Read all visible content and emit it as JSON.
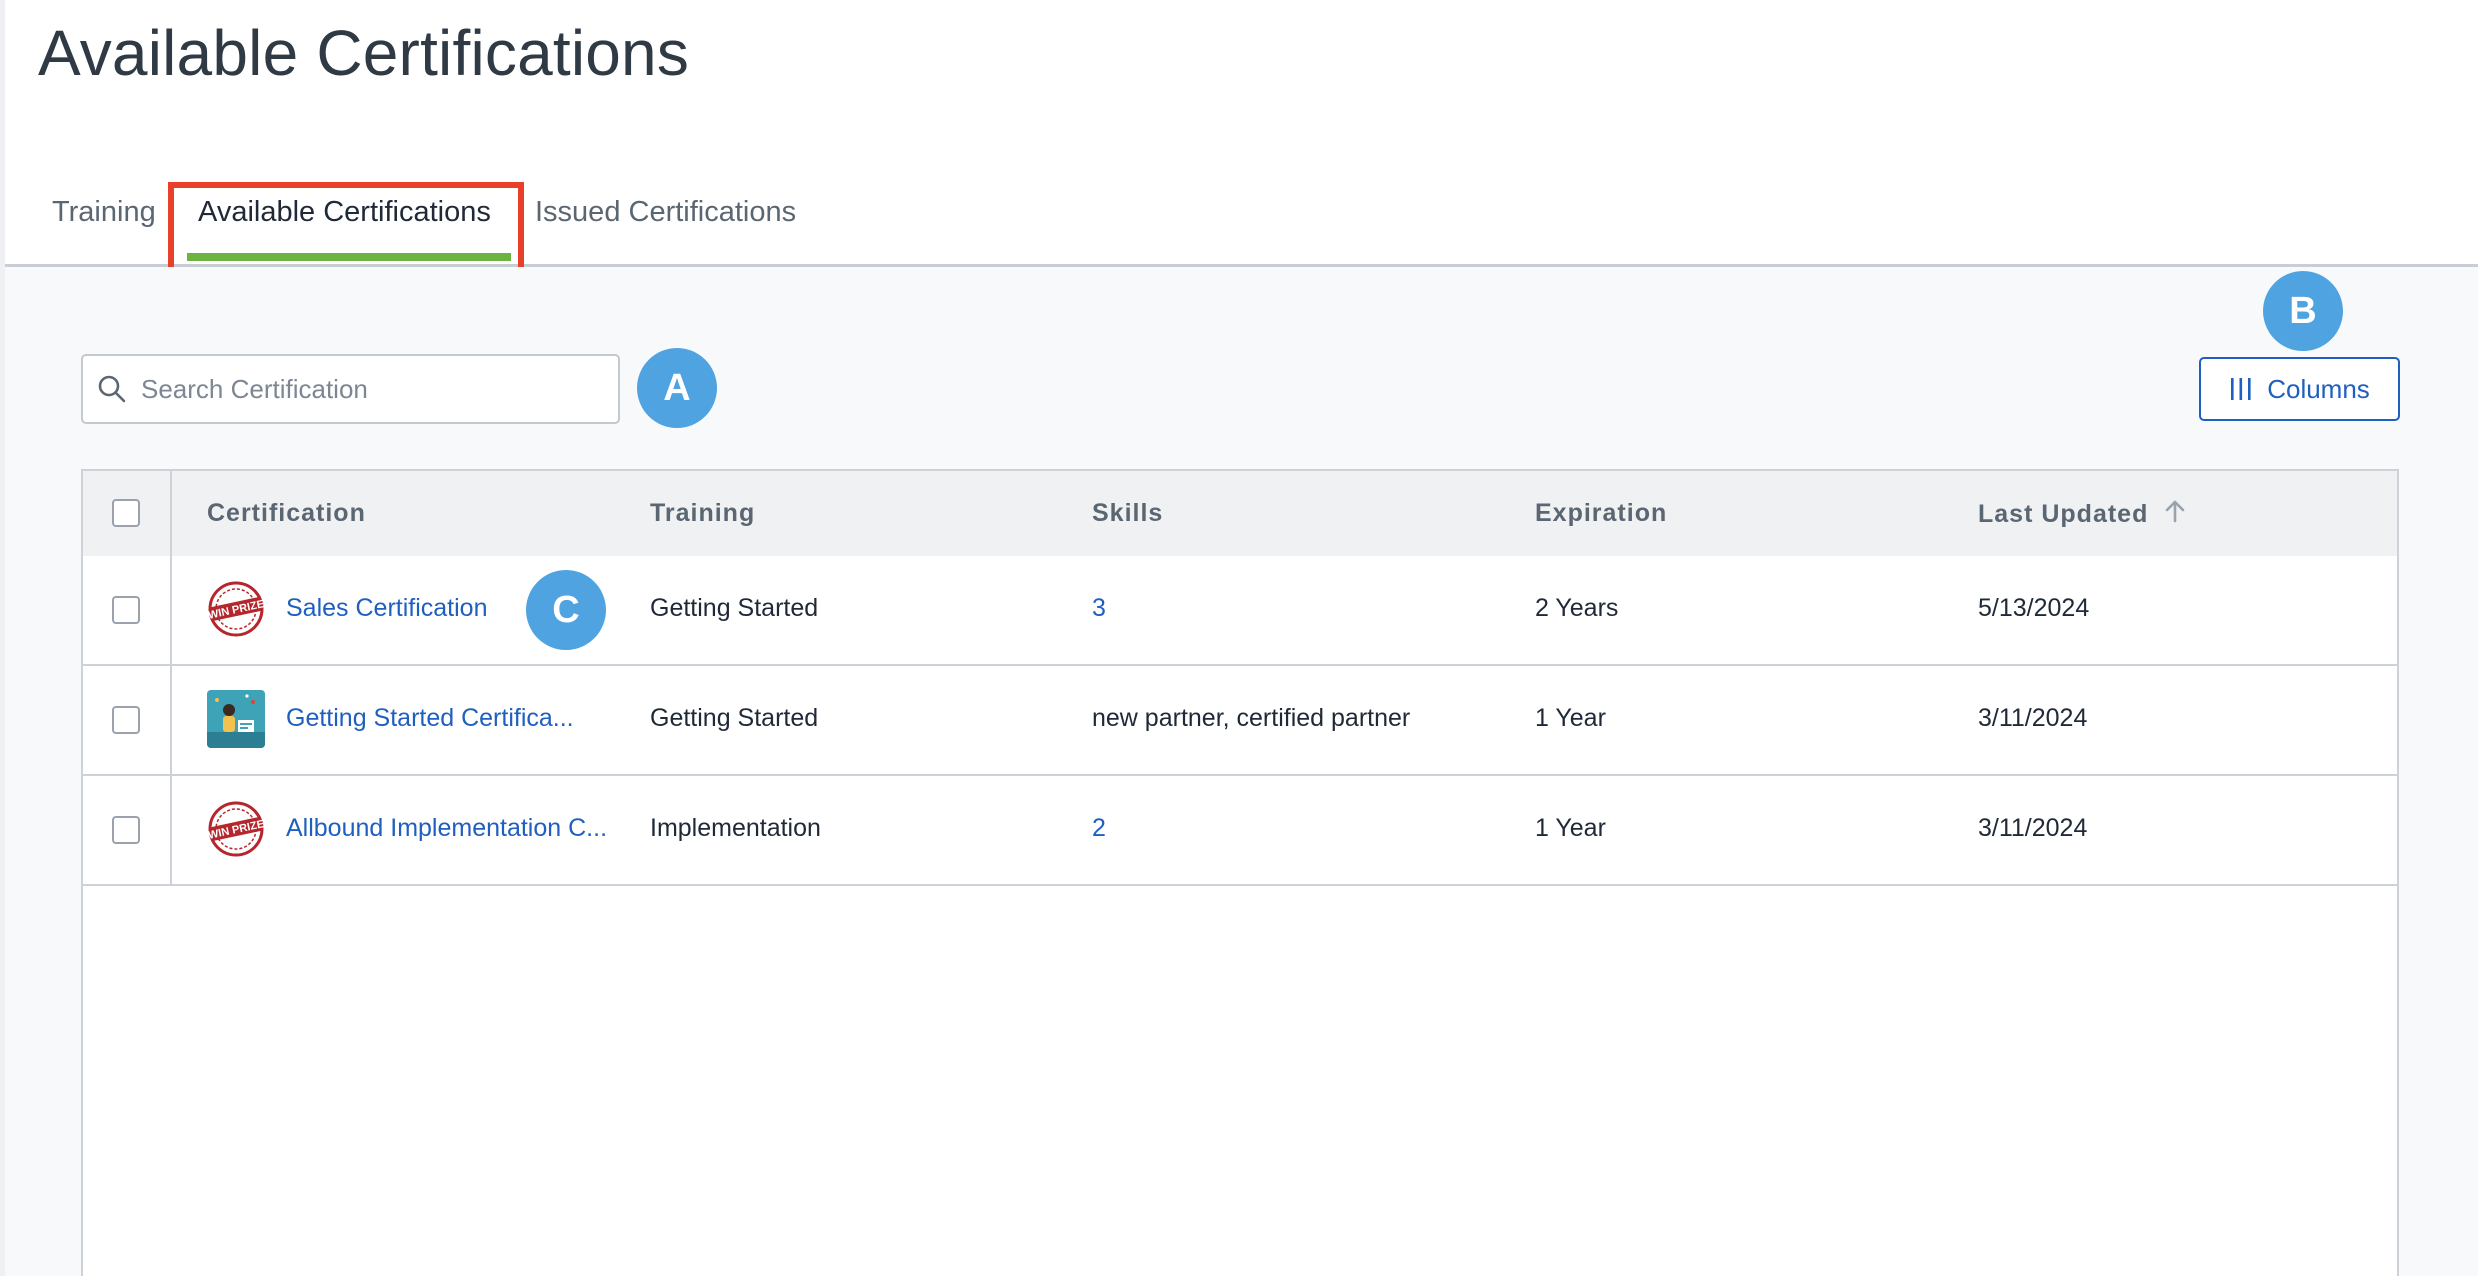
{
  "page": {
    "title": "Available Certifications"
  },
  "tabs": [
    {
      "label": "Training",
      "active": false
    },
    {
      "label": "Available Certifications",
      "active": true
    },
    {
      "label": "Issued Certifications",
      "active": false
    }
  ],
  "toolbar": {
    "search_placeholder": "Search Certification",
    "search_value": "",
    "columns_label": "Columns"
  },
  "callouts": {
    "a": "A",
    "b": "B",
    "c": "C"
  },
  "table": {
    "headers": {
      "certification": "Certification",
      "training": "Training",
      "skills": "Skills",
      "expiration": "Expiration",
      "last_updated": "Last Updated"
    },
    "sort": {
      "column": "Last Updated",
      "direction": "ascending"
    },
    "rows": [
      {
        "certification": "Sales Certification",
        "icon": "prize-stamp-icon",
        "training": "Getting Started",
        "skills": "3",
        "skills_is_link": true,
        "expiration": "2 Years",
        "last_updated": "5/13/2024"
      },
      {
        "certification": "Getting Started Certifica...",
        "icon": "celebration-illustration-icon",
        "training": "Getting Started",
        "skills": "new partner, certified partner",
        "skills_is_link": false,
        "expiration": "1 Year",
        "last_updated": "3/11/2024"
      },
      {
        "certification": "Allbound Implementation C...",
        "icon": "prize-stamp-icon",
        "training": "Implementation",
        "skills": "2",
        "skills_is_link": true,
        "expiration": "1 Year",
        "last_updated": "3/11/2024"
      }
    ]
  },
  "colors": {
    "accent_link": "#1f5fbf",
    "tab_underline": "#6cb33f",
    "highlight_box": "#e8402a",
    "callout_badge": "#4fa3e0"
  }
}
